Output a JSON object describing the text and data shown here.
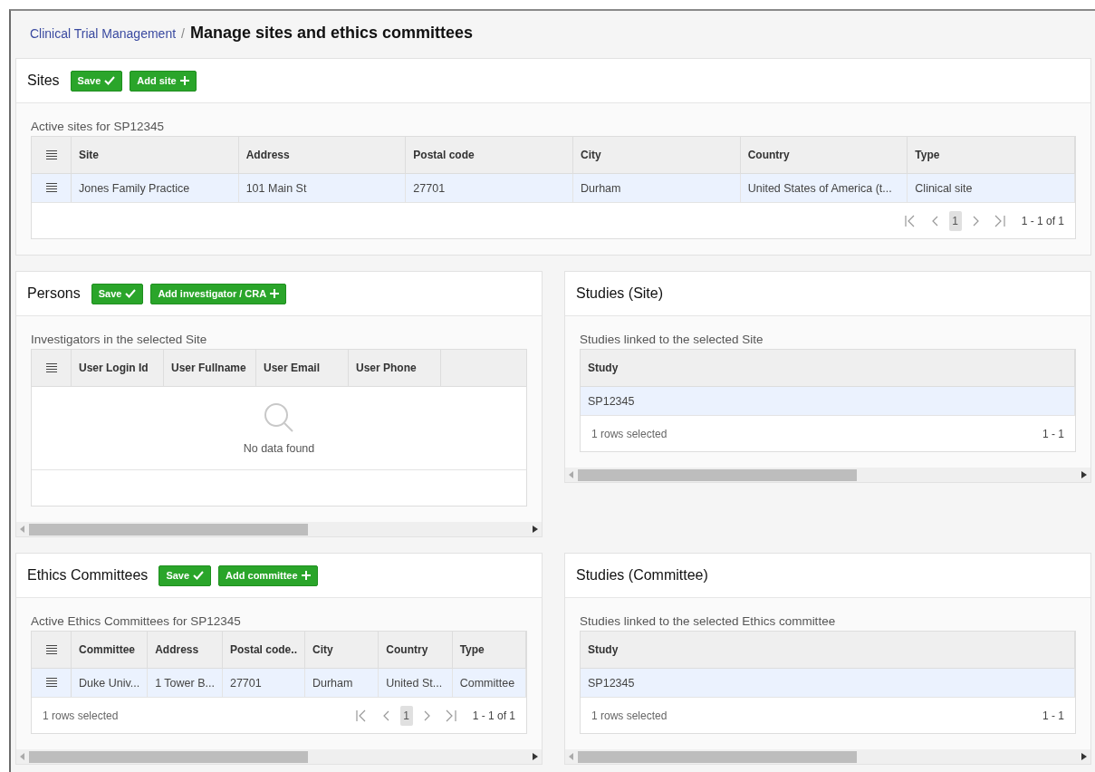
{
  "breadcrumb": {
    "parent": "Clinical Trial Management",
    "separator": "/",
    "current": "Manage sites and ethics committees"
  },
  "sites": {
    "title": "Sites",
    "buttons": [
      {
        "label": "Save",
        "kind": "save"
      },
      {
        "label": "Add site",
        "kind": "add"
      }
    ],
    "table": {
      "caption": "Active sites for SP12345",
      "row_handles": true,
      "columns": [
        "Site",
        "Address",
        "Postal code",
        "City",
        "Country",
        "Type"
      ],
      "rows": [
        {
          "selected": true,
          "cells": [
            "Jones Family Practice",
            "101 Main St",
            "27701",
            "Durham",
            "United States of America (t...",
            "Clinical site"
          ]
        }
      ],
      "footer": {
        "pager": {
          "pages": [
            {
              "label": "1",
              "selected": true
            }
          ],
          "range": "1 - 1 of 1"
        }
      }
    }
  },
  "persons": {
    "title": "Persons",
    "buttons": [
      {
        "label": "Save",
        "kind": "save"
      },
      {
        "label": "Add investigator / CRA",
        "kind": "add"
      }
    ],
    "scrollbar": true,
    "table": {
      "caption": "Investigators in the selected Site",
      "row_handles": true,
      "columns": [
        "User Login Id",
        "User Fullname",
        "User Email",
        "User Phone"
      ],
      "empty_text": "No data found"
    }
  },
  "studies_site": {
    "title": "Studies (Site)",
    "scrollbar": true,
    "table": {
      "caption": "Studies linked to the selected Site",
      "row_handles": false,
      "columns": [
        "Study"
      ],
      "rows": [
        {
          "selected": true,
          "cells": [
            "SP12345"
          ]
        }
      ],
      "footer": {
        "selection": "1 rows selected",
        "range": "1 - 1"
      }
    }
  },
  "ethics": {
    "title": "Ethics Committees",
    "buttons": [
      {
        "label": "Save",
        "kind": "save"
      },
      {
        "label": "Add committee",
        "kind": "add"
      }
    ],
    "scrollbar": true,
    "table": {
      "caption": "Active Ethics Committees for SP12345",
      "row_handles": true,
      "columns": [
        "Committee",
        "Address",
        "Postal code..",
        "City",
        "Country",
        "Type"
      ],
      "rows": [
        {
          "selected": true,
          "cells": [
            "Duke Univ...",
            "1 Tower B...",
            "27701",
            "Durham",
            "United St...",
            "Committee"
          ]
        }
      ],
      "footer": {
        "selection": "1 rows selected",
        "pager": {
          "pages": [
            {
              "label": "1",
              "selected": true
            }
          ],
          "range": "1 - 1 of 1"
        }
      }
    }
  },
  "studies_committee": {
    "title": "Studies (Committee)",
    "scrollbar": true,
    "table": {
      "caption": "Studies linked to the selected Ethics committee",
      "row_handles": false,
      "columns": [
        "Study"
      ],
      "rows": [
        {
          "selected": true,
          "cells": [
            "SP12345"
          ]
        }
      ],
      "footer": {
        "selection": "1 rows selected",
        "range": "1 - 1"
      }
    }
  }
}
